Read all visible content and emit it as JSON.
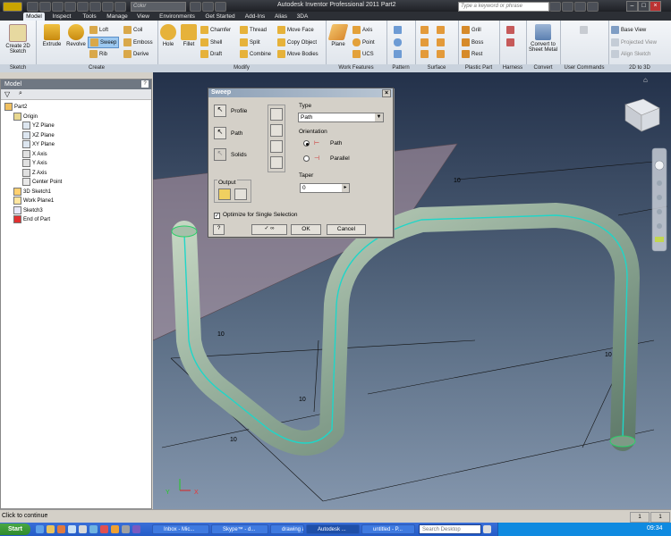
{
  "app": {
    "title": "Autodesk Inventor Professional 2011   Part2",
    "color_box": "Color",
    "search_placeholder": "Type a keyword or phrase"
  },
  "tabs": [
    "Model",
    "Inspect",
    "Tools",
    "Manage",
    "View",
    "Environments",
    "Get Started",
    "Add-Ins",
    "Alias",
    "3DA"
  ],
  "ribbon": {
    "sketch": {
      "create_label": "Create 2D Sketch",
      "panel": "Sketch"
    },
    "create": {
      "extrude": "Extrude",
      "revolve": "Revolve",
      "loft": "Loft",
      "sweep": "Sweep",
      "rib": "Rib",
      "coil": "Coil",
      "emboss": "Emboss",
      "derive": "Derive",
      "panel": "Create"
    },
    "modify": {
      "hole": "Hole",
      "fillet": "Fillet",
      "chamfer": "Chamfer",
      "shell": "Shell",
      "draft": "Draft",
      "thread": "Thread",
      "split": "Split",
      "combine": "Combine",
      "move_face": "Move Face",
      "copy_object": "Copy Object",
      "move_bodies": "Move Bodies",
      "panel": "Modify"
    },
    "work_features": {
      "plane": "Plane",
      "axis": "Axis",
      "point": "Point",
      "ucs": "UCS",
      "panel": "Work Features"
    },
    "pattern": {
      "panel": "Pattern"
    },
    "surface": {
      "panel": "Surface"
    },
    "plastic": {
      "grill": "Grill",
      "boss": "Boss",
      "rest": "Rest",
      "panel": "Plastic Part"
    },
    "harness": {
      "panel": "Harness"
    },
    "convert": {
      "sheet_metal": "Convert to Sheet Metal",
      "panel": "Convert"
    },
    "user_commands": {
      "panel": "User Commands"
    },
    "to3d": {
      "base_view": "Base View",
      "projected_view": "Projected View",
      "align_sketch": "Align Sketch",
      "panel": "2D to 3D"
    }
  },
  "browser": {
    "header": "Model",
    "tree": [
      {
        "label": "Part2",
        "level": 0
      },
      {
        "label": "Origin",
        "level": 1
      },
      {
        "label": "YZ Plane",
        "level": 2
      },
      {
        "label": "XZ Plane",
        "level": 2
      },
      {
        "label": "XY Plane",
        "level": 2
      },
      {
        "label": "X Axis",
        "level": 2
      },
      {
        "label": "Y Axis",
        "level": 2
      },
      {
        "label": "Z Axis",
        "level": 2
      },
      {
        "label": "Center Point",
        "level": 2
      },
      {
        "label": "3D Sketch1",
        "level": 1
      },
      {
        "label": "Work Plane1",
        "level": 1
      },
      {
        "label": "Sketch3",
        "level": 1
      },
      {
        "label": "End of Part",
        "level": 1
      }
    ]
  },
  "dialog": {
    "title": "Sweep",
    "profile": "Profile",
    "path": "Path",
    "solids": "Solids",
    "output": "Output",
    "type_label": "Type",
    "type_value": "Path",
    "orientation_label": "Orientation",
    "orient_path": "Path",
    "orient_parallel": "Parallel",
    "taper_label": "Taper",
    "taper_value": "0",
    "optimize": "Optimize for Single Selection",
    "ok": "OK",
    "cancel": "Cancel"
  },
  "viewport": {
    "dims": [
      "10",
      "10",
      "10",
      "10",
      "10"
    ],
    "axis_y": "Y",
    "axis_x": "X"
  },
  "status": {
    "text": "Click to continue",
    "count1": "1",
    "count2": "1"
  },
  "taskbar": {
    "start": "Start",
    "tasks": [
      "Inbox - Mic...",
      "Skype™ - d...",
      "drawing a h...",
      "Autodesk ...",
      "untitled - P..."
    ],
    "search": "Search Desktop",
    "clock": "09:34"
  }
}
